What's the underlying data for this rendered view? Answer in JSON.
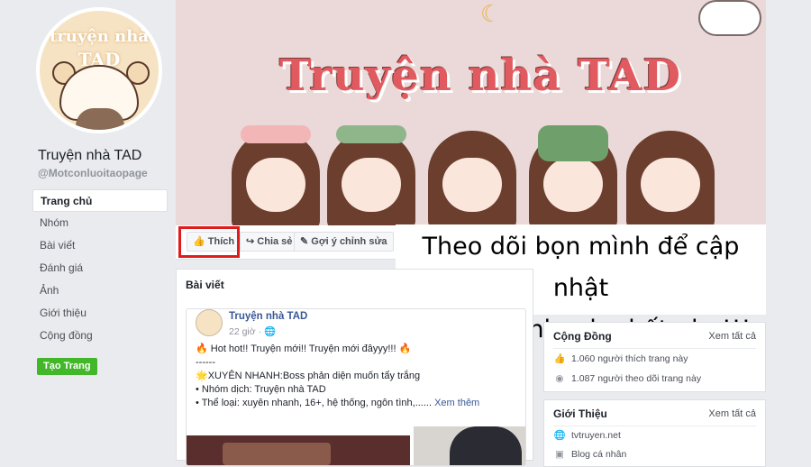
{
  "sidebar": {
    "avatar_line1": "truyện nhà",
    "avatar_line2": "TAD",
    "page_name": "Truyện nhà TAD",
    "page_handle": "@Motconluoitaopage",
    "nav": [
      "Trang chủ",
      "Nhóm",
      "Bài viết",
      "Đánh giá",
      "Ảnh",
      "Giới thiệu",
      "Cộng đồng"
    ],
    "create_page": "Tạo Trang"
  },
  "cover": {
    "title": "Truyện nhà TAD"
  },
  "actions": {
    "like": "Thích",
    "share": "Chia sẻ",
    "suggest_edit": "Gợi ý chỉnh sửa"
  },
  "caption": {
    "line1": "Theo dõi bọn mình để cập nhật",
    "line2": "thông tin nhanh nhất nha!!!"
  },
  "posts": {
    "title": "Bài viết",
    "post": {
      "author": "Truyện nhà TAD",
      "time": "22 giờ · ",
      "line1": "🔥 Hot hot!! Truyện mới!! Truyện mới đâyyy!!! 🔥",
      "line2": "------",
      "line3": "🌟XUYÊN NHANH:Boss phản diện muốn tẩy trắng",
      "line4": "• Nhóm dịch: Truyện nhà TAD",
      "line5": "• Thể loại: xuyên nhanh, 16+, hệ thống, ngôn tình,...... ",
      "see_more": "Xem thêm"
    }
  },
  "community": {
    "title": "Cộng Đồng",
    "see_all": "Xem tất cả",
    "likes": "1.060 người thích trang này",
    "follows": "1.087 người theo dõi trang này"
  },
  "about": {
    "title": "Giới Thiệu",
    "see_all": "Xem tất cả",
    "website": "tvtruyen.net",
    "category": "Blog cá nhân"
  }
}
